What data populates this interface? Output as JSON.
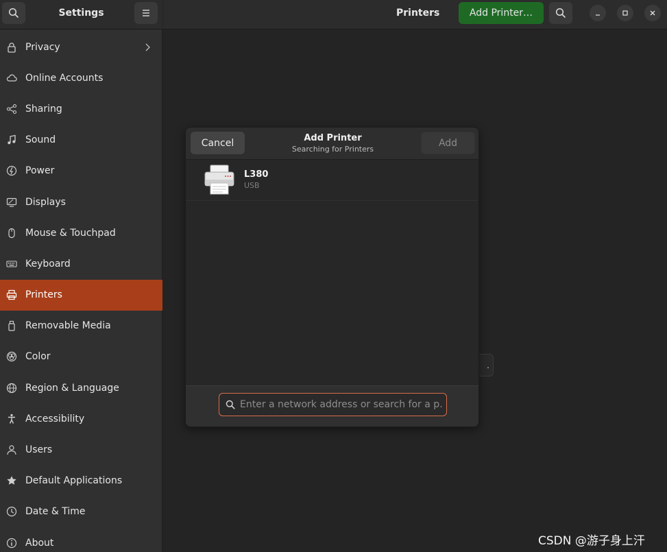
{
  "sidebar": {
    "title": "Settings",
    "items": [
      {
        "label": "Privacy",
        "icon": "lock-icon",
        "has_chevron": true
      },
      {
        "label": "Online Accounts",
        "icon": "cloud-icon"
      },
      {
        "label": "Sharing",
        "icon": "share-icon"
      },
      {
        "label": "Sound",
        "icon": "music-note-icon"
      },
      {
        "label": "Power",
        "icon": "power-icon"
      },
      {
        "label": "Displays",
        "icon": "display-icon"
      },
      {
        "label": "Mouse & Touchpad",
        "icon": "mouse-icon"
      },
      {
        "label": "Keyboard",
        "icon": "keyboard-icon"
      },
      {
        "label": "Printers",
        "icon": "printer-icon",
        "active": true
      },
      {
        "label": "Removable Media",
        "icon": "usb-drive-icon"
      },
      {
        "label": "Color",
        "icon": "color-icon"
      },
      {
        "label": "Region & Language",
        "icon": "globe-icon"
      },
      {
        "label": "Accessibility",
        "icon": "accessibility-icon"
      },
      {
        "label": "Users",
        "icon": "users-icon"
      },
      {
        "label": "Default Applications",
        "icon": "star-icon"
      },
      {
        "label": "Date & Time",
        "icon": "clock-icon"
      },
      {
        "label": "About",
        "icon": "info-icon"
      }
    ]
  },
  "header": {
    "title": "Printers",
    "add_printer_label": "Add Printer…"
  },
  "background": {
    "fragment_text": "."
  },
  "dialog": {
    "title": "Add Printer",
    "subtitle": "Searching for Printers",
    "cancel_label": "Cancel",
    "add_label": "Add",
    "printers": [
      {
        "name": "L380",
        "connection": "USB"
      }
    ],
    "search": {
      "value": "",
      "placeholder": "Enter a network address or search for a p…"
    }
  },
  "watermark": "CSDN @游子身上汗",
  "colors": {
    "accent": "#a83f1a",
    "add_printer_green": "#1e6a25",
    "search_focus": "#d96d4a"
  }
}
